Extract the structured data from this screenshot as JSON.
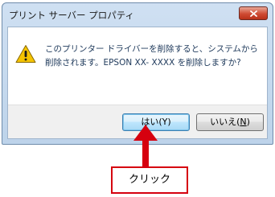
{
  "dialog": {
    "title": "プリント サーバー プロパティ",
    "message": "このプリンター ドライバーを削除すると、システムから削除されます。EPSON XX- XXXX を削除しますか?",
    "yes_label": "はい(Y)",
    "no_label_main": "いいえ(",
    "no_label_mnemonic": "N",
    "no_label_end": ")"
  },
  "annotation": {
    "callout_label": "クリック"
  },
  "icons": {
    "warning": "warning-icon",
    "close": "close-icon",
    "arrow": "up-arrow-icon"
  },
  "colors": {
    "annotation_red": "#d6000f",
    "warning_yellow": "#f5c400",
    "title_bar": "#c4d8ee"
  }
}
